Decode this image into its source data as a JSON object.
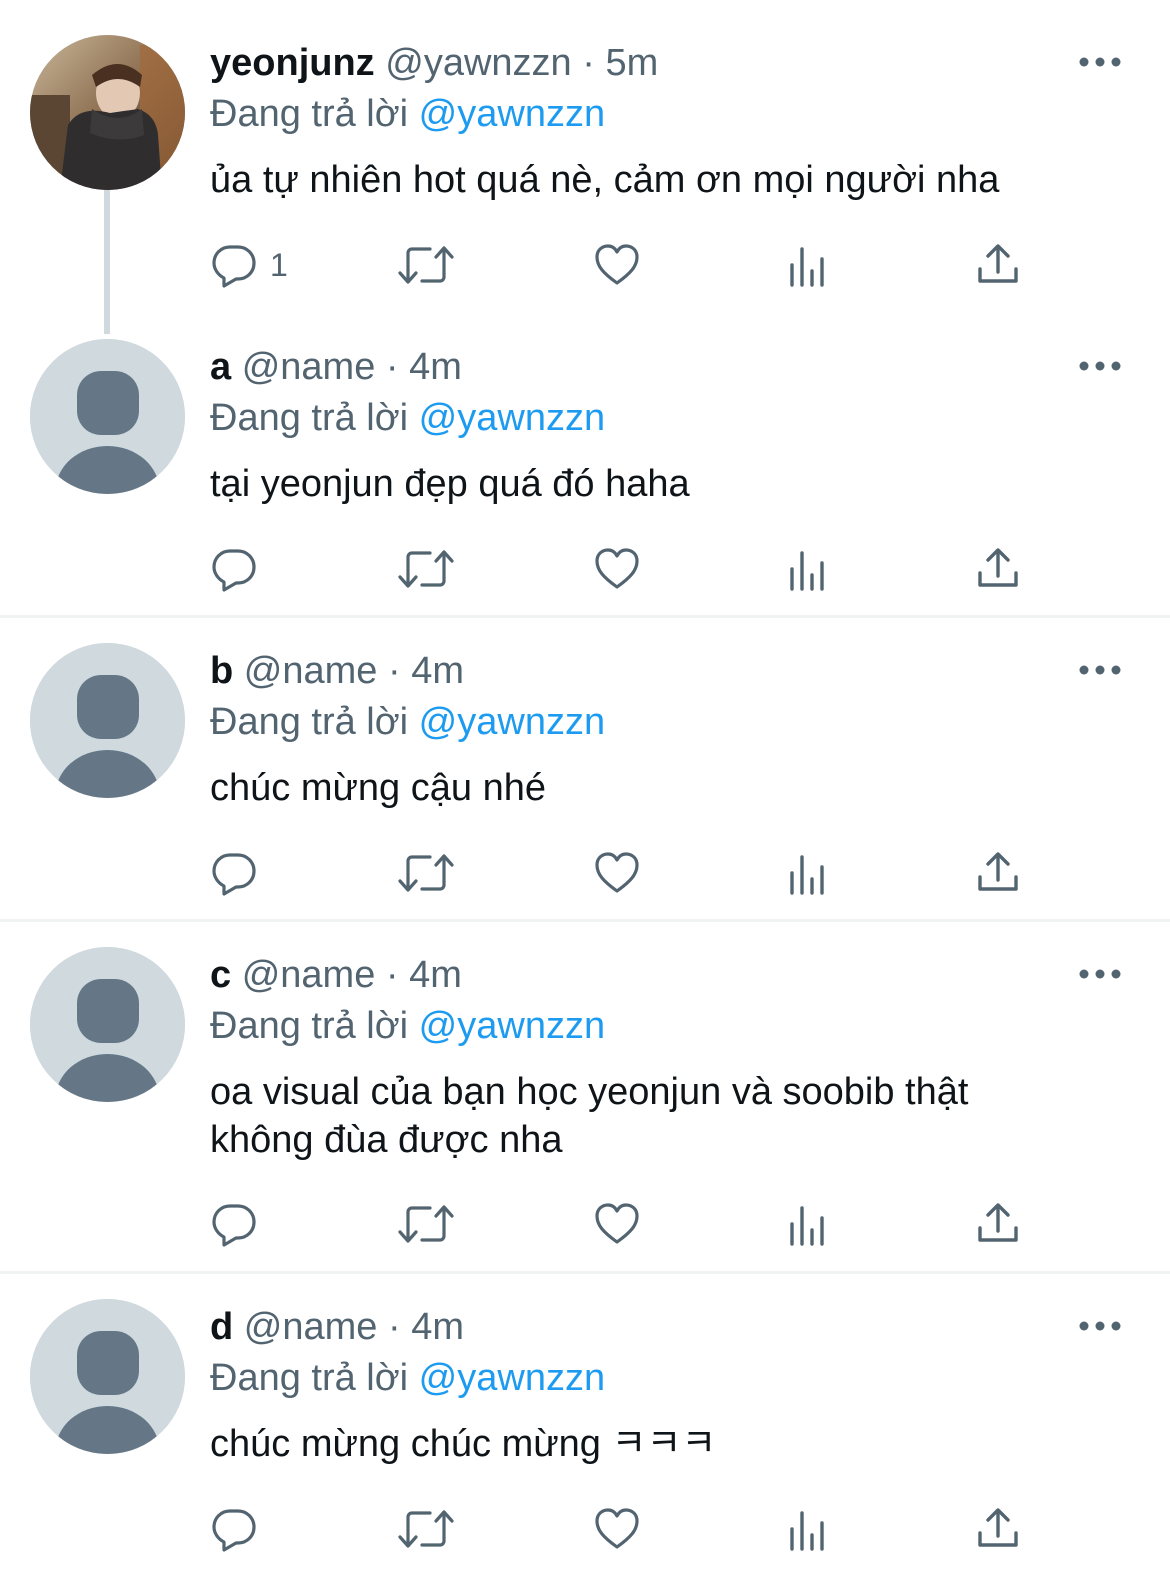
{
  "colors": {
    "text": "#0f1419",
    "secondary": "#536471",
    "accent": "#1d9bf0",
    "avatar_bg": "#cfd9de",
    "avatar_fg": "#657786",
    "divider": "#eff3f4"
  },
  "tweets": [
    {
      "display_name": "yeonjunz",
      "handle": "@yawnzzn",
      "separator": "·",
      "time": "5m",
      "replying_prefix": "Đang trả lời",
      "replying_to": "@yawnzzn",
      "text": "ủa tự nhiên hot quá nè, cảm ơn mọi người nha",
      "reply_count": "1",
      "avatar": "photo"
    },
    {
      "display_name": "a",
      "handle": "@name",
      "separator": "·",
      "time": "4m",
      "replying_prefix": "Đang trả lời",
      "replying_to": "@yawnzzn",
      "text": "tại yeonjun đẹp quá đó haha",
      "reply_count": "",
      "avatar": "default-person"
    },
    {
      "display_name": "b",
      "handle": "@name",
      "separator": "·",
      "time": "4m",
      "replying_prefix": "Đang trả lời",
      "replying_to": "@yawnzzn",
      "text": "chúc mừng cậu nhé",
      "reply_count": "",
      "avatar": "default-person"
    },
    {
      "display_name": "c",
      "handle": "@name",
      "separator": "·",
      "time": "4m",
      "replying_prefix": "Đang trả lời",
      "replying_to": "@yawnzzn",
      "text": "oa visual của bạn học yeonjun và soobib thật không đùa được nha",
      "reply_count": "",
      "avatar": "default-person"
    },
    {
      "display_name": "d",
      "handle": "@name",
      "separator": "·",
      "time": "4m",
      "replying_prefix": "Đang trả lời",
      "replying_to": "@yawnzzn",
      "text": "chúc mừng chúc mừng ㅋㅋㅋ",
      "reply_count": "",
      "avatar": "default-person"
    }
  ],
  "action_icons": [
    "reply-icon",
    "retweet-icon",
    "like-icon",
    "views-icon",
    "share-icon"
  ]
}
